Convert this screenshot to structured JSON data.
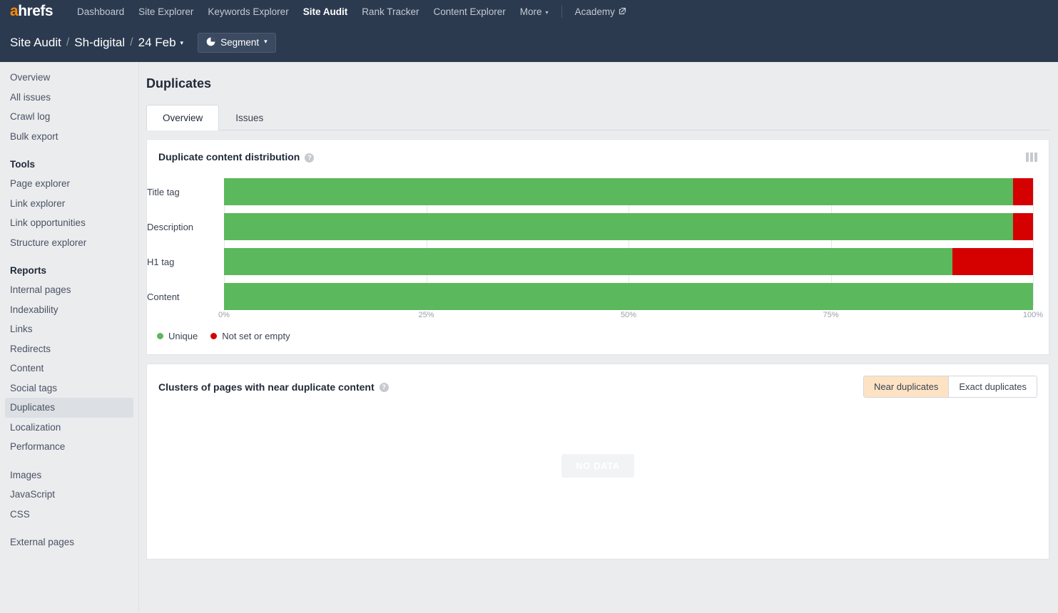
{
  "topnav": {
    "logo": {
      "accent_letter": "a",
      "rest": "hrefs",
      "accent_color": "#ff8800"
    },
    "links": [
      {
        "label": "Dashboard",
        "active": false
      },
      {
        "label": "Site Explorer",
        "active": false
      },
      {
        "label": "Keywords Explorer",
        "active": false
      },
      {
        "label": "Site Audit",
        "active": true
      },
      {
        "label": "Rank Tracker",
        "active": false
      },
      {
        "label": "Content Explorer",
        "active": false
      },
      {
        "label": "More",
        "active": false,
        "caret": "▾"
      }
    ],
    "academy": {
      "label": "Academy",
      "external_icon": "external-link-icon"
    }
  },
  "breadcrumb": {
    "root": "Site Audit",
    "sep": "/",
    "project": "Sh-digital",
    "date": "24 Feb",
    "date_caret": "▾",
    "segment_button": {
      "label": "Segment",
      "icon": "pie-chart-icon",
      "caret": "▾"
    }
  },
  "sidebar": {
    "top_items": [
      {
        "label": "Overview"
      },
      {
        "label": "All issues"
      },
      {
        "label": "Crawl log"
      },
      {
        "label": "Bulk export"
      }
    ],
    "tools_heading": "Tools",
    "tools_items": [
      {
        "label": "Page explorer"
      },
      {
        "label": "Link explorer"
      },
      {
        "label": "Link opportunities"
      },
      {
        "label": "Structure explorer"
      }
    ],
    "reports_heading": "Reports",
    "reports_items": [
      {
        "label": "Internal pages",
        "selected": false
      },
      {
        "label": "Indexability",
        "selected": false
      },
      {
        "label": "Links",
        "selected": false
      },
      {
        "label": "Redirects",
        "selected": false
      },
      {
        "label": "Content",
        "selected": false
      },
      {
        "label": "Social tags",
        "selected": false
      },
      {
        "label": "Duplicates",
        "selected": true
      },
      {
        "label": "Localization",
        "selected": false
      },
      {
        "label": "Performance",
        "selected": false
      }
    ],
    "assets_items": [
      {
        "label": "Images"
      },
      {
        "label": "JavaScript"
      },
      {
        "label": "CSS"
      }
    ],
    "external_items": [
      {
        "label": "External pages"
      }
    ]
  },
  "main": {
    "page_title": "Duplicates",
    "tabs": [
      {
        "label": "Overview",
        "active": true
      },
      {
        "label": "Issues",
        "active": false
      }
    ]
  },
  "distribution_card": {
    "title": "Duplicate content distribution",
    "help_icon": "help-circle-icon",
    "columns_icon": "columns-icon"
  },
  "clusters_card": {
    "title": "Clusters of pages with near duplicate content",
    "help_icon": "help-circle-icon",
    "toggles": [
      {
        "label": "Near duplicates",
        "active": true
      },
      {
        "label": "Exact duplicates",
        "active": false
      }
    ],
    "empty_state": "NO DATA"
  },
  "chart_data": {
    "type": "bar",
    "orientation": "horizontal",
    "stacked": true,
    "title": "Duplicate content distribution",
    "xlabel": "",
    "ylabel": "",
    "xlim": [
      0,
      100
    ],
    "xticks": [
      0,
      25,
      50,
      75,
      100
    ],
    "xtick_labels": [
      "0%",
      "25%",
      "50%",
      "75%",
      "100%"
    ],
    "grid": true,
    "legend_position": "bottom-left",
    "categories": [
      "Title tag",
      "Description",
      "H1 tag",
      "Content"
    ],
    "series": [
      {
        "name": "Unique",
        "color": "#5cb85c",
        "values": [
          97.5,
          97.5,
          90,
          100
        ]
      },
      {
        "name": "Not set or empty",
        "color": "#d50000",
        "values": [
          2.5,
          2.5,
          10,
          0
        ]
      }
    ]
  }
}
